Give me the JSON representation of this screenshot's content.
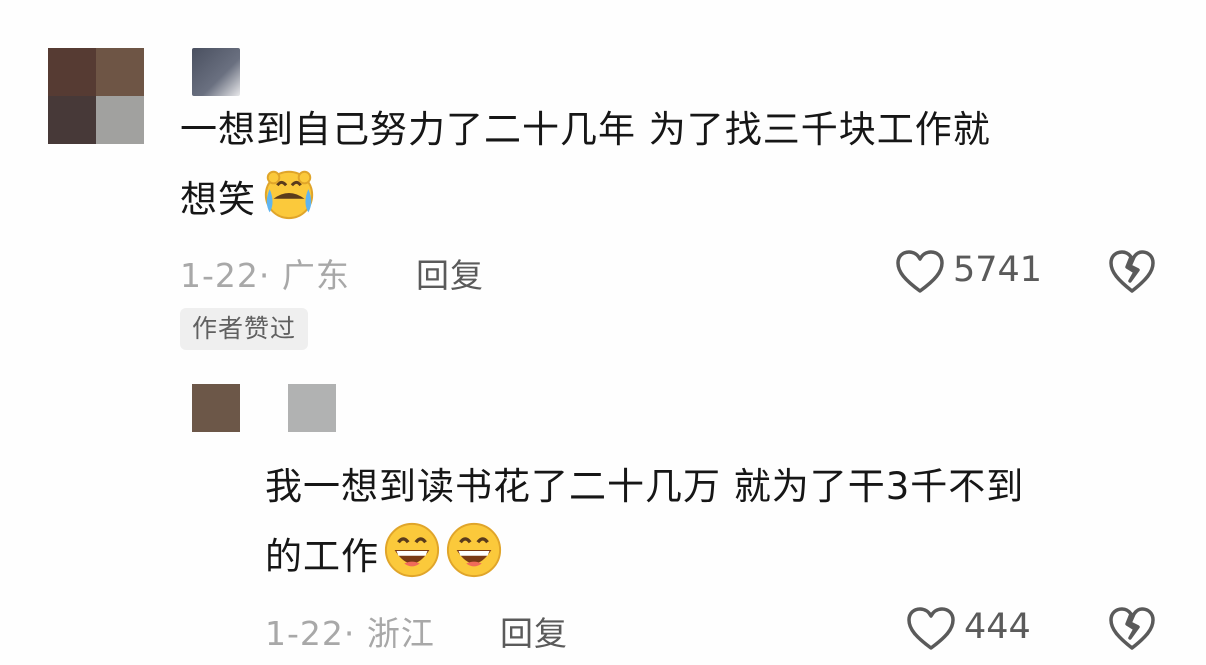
{
  "comments": [
    {
      "text": "一想到自己努力了二十几年 为了找三千块工作就",
      "text_cont": "想笑",
      "emojis": [
        "crying-face-icon"
      ],
      "date": "1-22",
      "location": "· 广东",
      "reply_label": "回复",
      "likes": "5741",
      "badge": "作者赞过"
    },
    {
      "text": "我一想到读书花了二十几万 就为了干3千不到",
      "text_cont": "的工作",
      "emojis": [
        "grinning-face-icon",
        "grinning-face-icon"
      ],
      "date": "1-22",
      "location": "· 浙江",
      "reply_label": "回复",
      "likes": "444"
    }
  ],
  "colors": {
    "text": "#161616",
    "meta": "#a8a8a8",
    "action": "#5a5a5a",
    "badge_bg": "#efefef"
  }
}
